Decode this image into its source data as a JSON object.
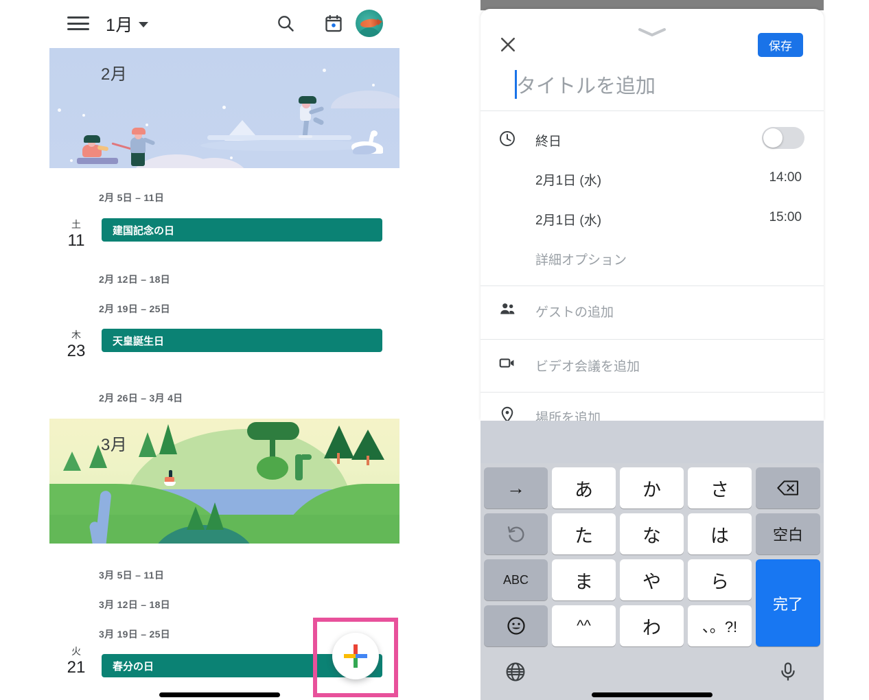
{
  "left_phone": {
    "appbar": {
      "menu_icon": "hamburger-menu-icon",
      "month_label": "1月",
      "dropdown_icon": "caret-down-icon",
      "search_icon": "search-icon",
      "calendar_icon": "calendar-today-icon",
      "avatar_icon": "account-avatar-fish"
    },
    "banners": [
      {
        "title": "2月",
        "theme": "winter-skating-illustration"
      },
      {
        "title": "3月",
        "theme": "spring-lake-hills-illustration"
      }
    ],
    "weeks": [
      {
        "range": "2月 5日 – 11日"
      },
      {
        "range": "2月 12日 – 18日"
      },
      {
        "range": "2月 19日 – 25日"
      },
      {
        "range": "2月 26日 – 3月 4日"
      },
      {
        "range": "3月 5日 – 11日"
      },
      {
        "range": "3月 12日 – 18日"
      },
      {
        "range": "3月 19日 – 25日"
      }
    ],
    "events": [
      {
        "dow": "土",
        "day": "11",
        "title": "建国記念の日",
        "color": "#0b8274"
      },
      {
        "dow": "木",
        "day": "23",
        "title": "天皇誕生日",
        "color": "#0b8274"
      },
      {
        "dow": "火",
        "day": "21",
        "title": "春分の日",
        "color": "#0b8274"
      }
    ],
    "fab": {
      "icon": "google-plus-icon",
      "colors": [
        "#ea4335",
        "#4285f4",
        "#34a853",
        "#fbbc04"
      ]
    },
    "highlight_box_color": "#e8519b"
  },
  "right_phone": {
    "sheet": {
      "close_icon": "close-x-icon",
      "handle_icon": "chevron-down-handle-icon",
      "save_label": "保存",
      "save_color": "#1a73e8",
      "title_placeholder": "タイトルを追加"
    },
    "fields": [
      {
        "icon": "clock-icon",
        "label": "終日",
        "type": "toggle",
        "toggle_on": false
      },
      {
        "label": "2月1日 (水)",
        "value": "14:00",
        "type": "date-time"
      },
      {
        "label": "2月1日 (水)",
        "value": "15:00",
        "type": "date-time"
      },
      {
        "label": "詳細オプション",
        "type": "link",
        "muted": true
      }
    ],
    "options": [
      {
        "icon": "people-icon",
        "label": "ゲストの追加"
      },
      {
        "icon": "video-camera-icon",
        "label": "ビデオ会議を追加"
      },
      {
        "icon": "location-pin-icon",
        "label": "場所を追加"
      }
    ],
    "keyboard": {
      "rows": [
        [
          {
            "label": "→",
            "style": "gray"
          },
          {
            "label": "あ",
            "style": "white"
          },
          {
            "label": "か",
            "style": "white"
          },
          {
            "label": "さ",
            "style": "white"
          },
          {
            "label": "⌫",
            "style": "gray",
            "icon": "backspace-icon"
          }
        ],
        [
          {
            "label": "↺",
            "style": "gray",
            "icon": "undo-icon"
          },
          {
            "label": "た",
            "style": "white"
          },
          {
            "label": "な",
            "style": "white"
          },
          {
            "label": "は",
            "style": "white"
          },
          {
            "label": "空白",
            "style": "gray"
          }
        ],
        [
          {
            "label": "ABC",
            "style": "gray"
          },
          {
            "label": "ま",
            "style": "white"
          },
          {
            "label": "や",
            "style": "white"
          },
          {
            "label": "ら",
            "style": "white"
          },
          {
            "label": "完了",
            "style": "blue"
          }
        ],
        [
          {
            "label": "☺",
            "style": "gray",
            "icon": "emoji-icon"
          },
          {
            "label": "^^",
            "style": "white"
          },
          {
            "label": "わ",
            "style": "white"
          },
          {
            "label": "、。?!",
            "style": "white"
          }
        ]
      ],
      "bottom": {
        "globe_icon": "language-globe-icon",
        "mic_icon": "microphone-icon"
      }
    }
  }
}
